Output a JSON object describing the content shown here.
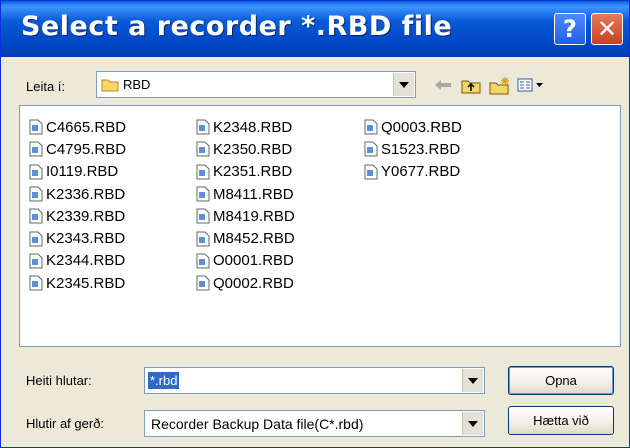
{
  "title_bar": {
    "title": "Select a recorder *.RBD file",
    "help_glyph": "?",
    "close_glyph": "✕"
  },
  "look_in": {
    "label": "Leita í:",
    "value": "RBD"
  },
  "toolbar_icons": [
    "back-arrow-icon",
    "up-folder-icon",
    "new-folder-icon",
    "view-menu-icon"
  ],
  "files": {
    "column1": [
      "C4665.RBD",
      "C4795.RBD",
      "I0119.RBD",
      "K2336.RBD",
      "K2339.RBD",
      "K2343.RBD",
      "K2344.RBD",
      "K2345.RBD"
    ],
    "column2": [
      "K2348.RBD",
      "K2350.RBD",
      "K2351.RBD",
      "M8411.RBD",
      "M8419.RBD",
      "M8452.RBD",
      "O0001.RBD",
      "Q0002.RBD"
    ],
    "column3": [
      "Q0003.RBD",
      "S1523.RBD",
      "Y0677.RBD"
    ]
  },
  "file_name": {
    "label": "Heiti hlutar:",
    "value": "*.rbd"
  },
  "file_type": {
    "label": "Hlutir af gerð:",
    "value": "Recorder Backup Data file(C*.rbd)"
  },
  "buttons": {
    "open": "Opna",
    "cancel": "Hætta við"
  },
  "colors": {
    "title_bar": "#0a5bd8",
    "selection": "#316ac5",
    "dialog_bg": "#ece9d8"
  }
}
